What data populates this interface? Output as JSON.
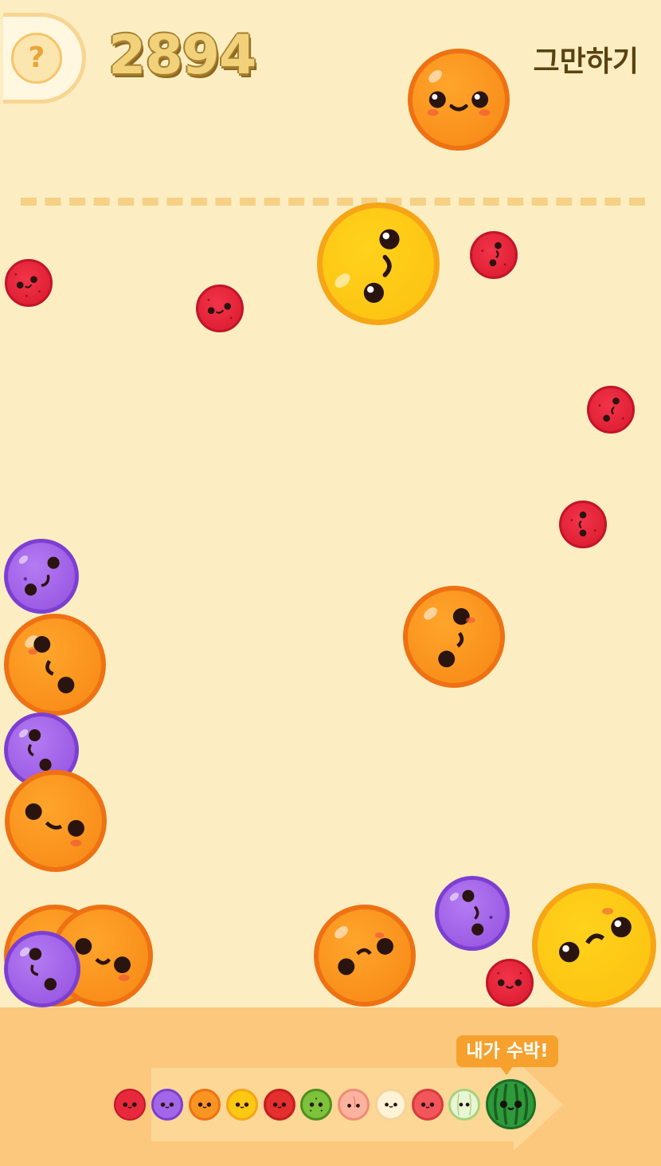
{
  "header": {
    "help_label": "?",
    "score": "2894",
    "quit_label": "그만하기"
  },
  "colors": {
    "background": "#FCEEC2",
    "tray": "#FCC87D",
    "deadline": "#F6D085",
    "score_fill": "#F1D27A",
    "cherry": "#E8283C",
    "grape": "#A266E8",
    "orange": "#F89520",
    "lemon": "#FCC812",
    "watermelon": "#2E9A3A"
  },
  "evolution": {
    "tip_label": "내가 수박!",
    "stages": [
      "cherry",
      "grape",
      "orange",
      "lemon",
      "apple",
      "kiwi",
      "peach",
      "pear",
      "tomato",
      "melon",
      "watermelon"
    ]
  },
  "board_fruits": [
    "orange",
    "lemon",
    "cherry",
    "cherry",
    "cherry",
    "cherry",
    "cherry",
    "grape",
    "orange",
    "orange",
    "grape",
    "orange",
    "orange",
    "orange",
    "grape",
    "orange",
    "grape",
    "lemon",
    "cherry"
  ]
}
